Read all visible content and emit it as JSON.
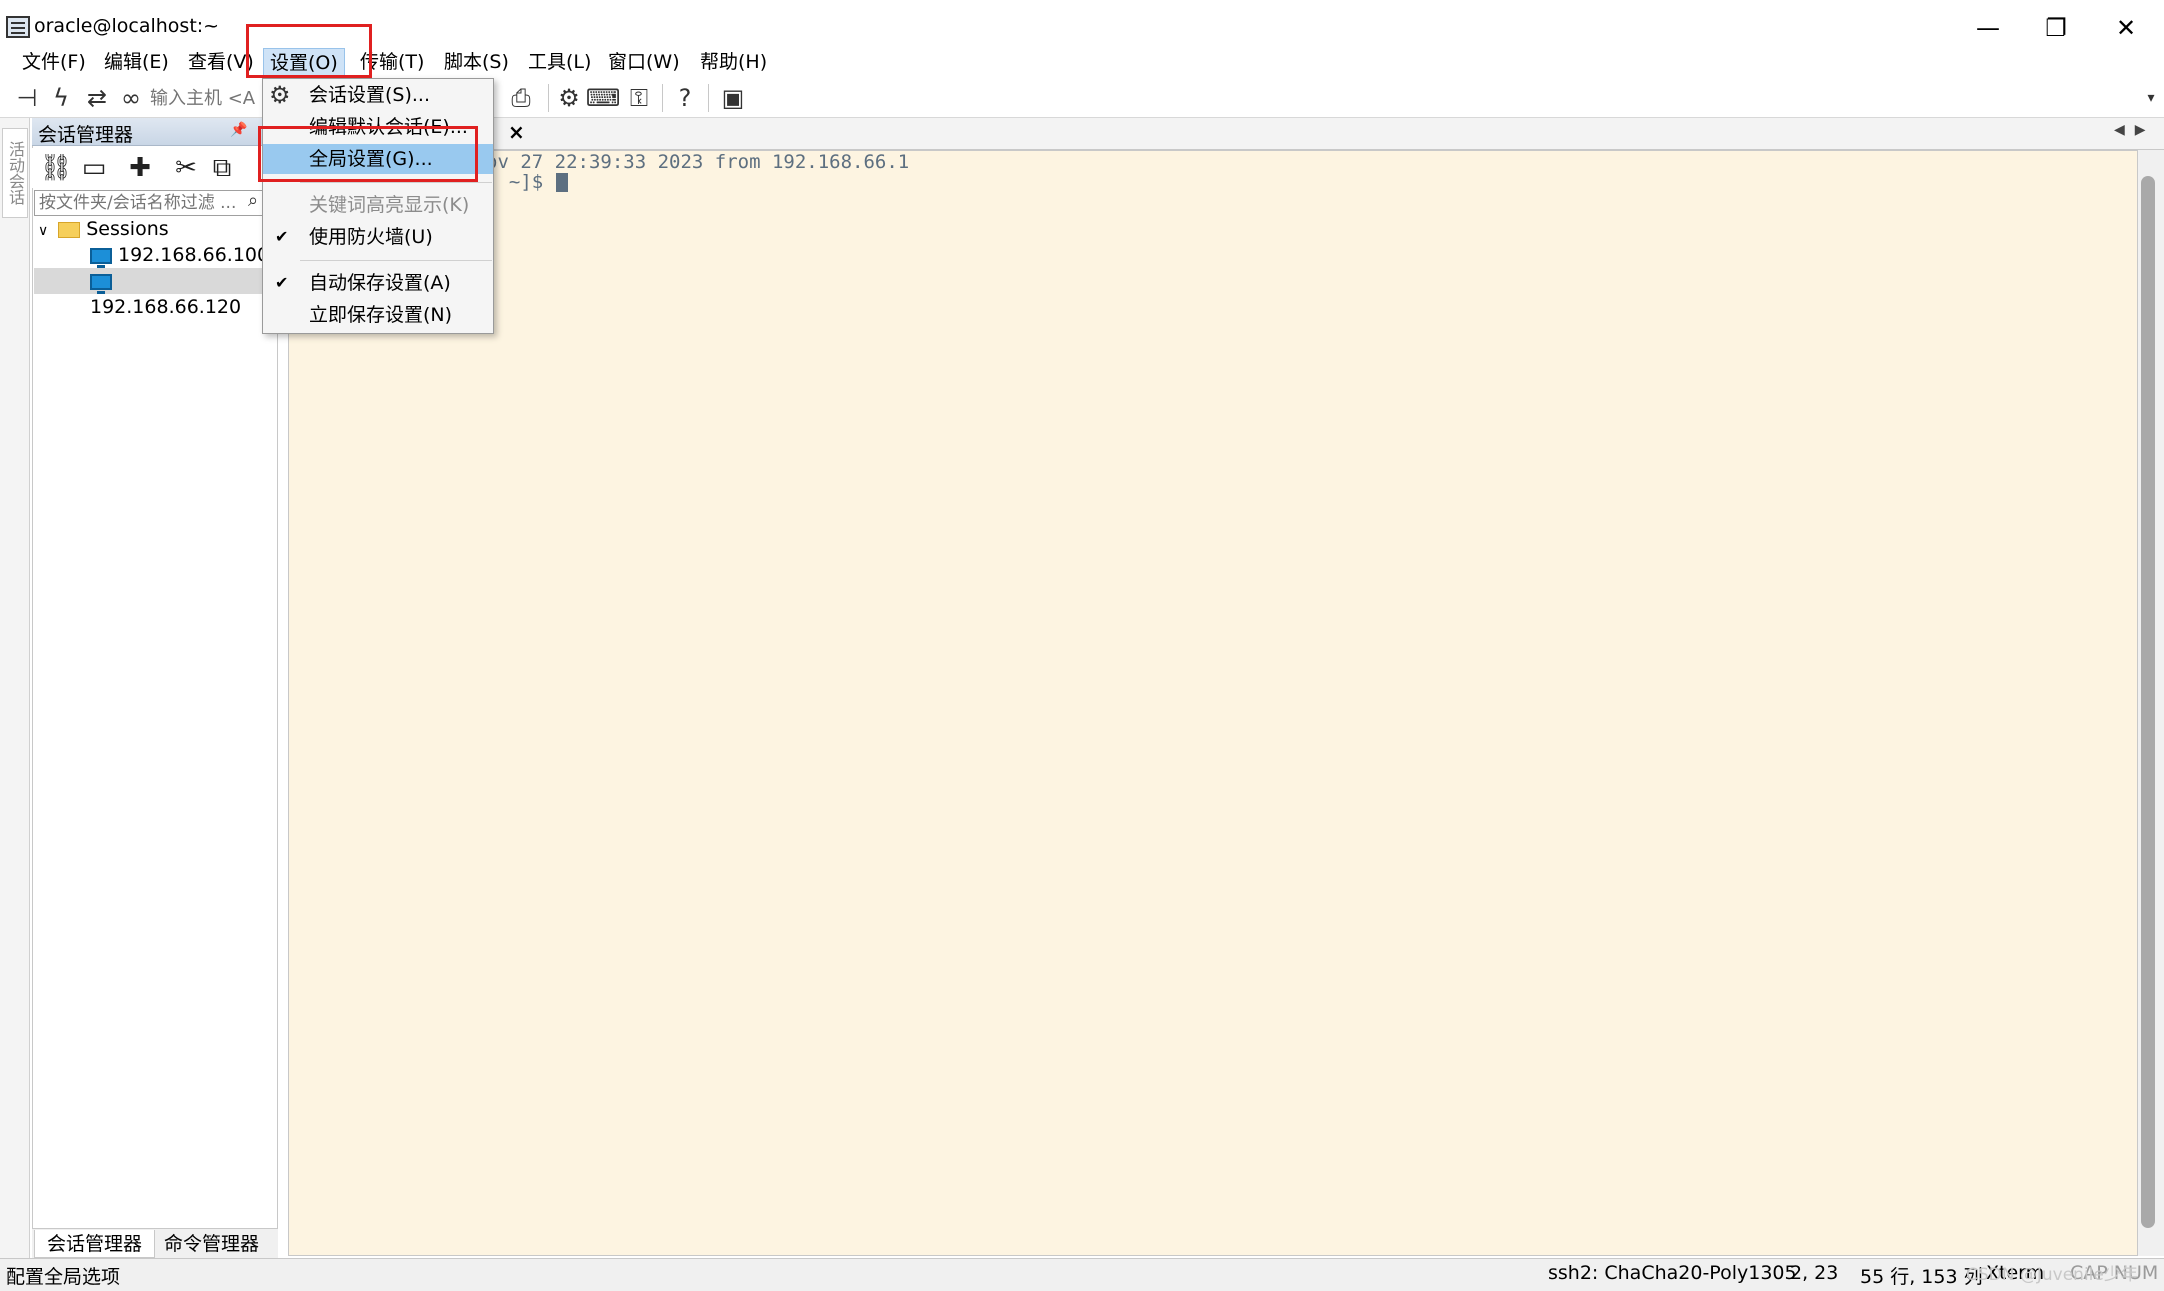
{
  "window": {
    "title": "oracle@localhost:~",
    "minimize": "—",
    "maximize": "❐",
    "close": "✕"
  },
  "menubar": [
    {
      "label": "文件(F)"
    },
    {
      "label": "编辑(E)"
    },
    {
      "label": "查看(V)"
    },
    {
      "label": "设置(O)"
    },
    {
      "label": "传输(T)"
    },
    {
      "label": "脚本(S)"
    },
    {
      "label": "工具(L)"
    },
    {
      "label": "窗口(W)"
    },
    {
      "label": "帮助(H)"
    }
  ],
  "toolbar": {
    "host_placeholder": "输入主机 <A"
  },
  "side_strip": {
    "tab_label": "活动会话"
  },
  "session_manager": {
    "title": "会话管理器",
    "filter_placeholder": "按文件夹/会话名称过滤 ...",
    "tree": {
      "root": "Sessions",
      "sessions": [
        "192.168.66.100",
        "192.168.66.120"
      ]
    },
    "bottom_tabs": [
      "会话管理器",
      "命令管理器"
    ]
  },
  "terminal": {
    "line1": "ov 27 22:39:33 2023 from 192.168.66.1",
    "line2": ": ~]$ "
  },
  "dropdown": {
    "items": [
      {
        "label": "会话设置(S)...",
        "icon": "gear-icon"
      },
      {
        "label": "编辑默认会话(E)..."
      },
      {
        "label": "全局设置(G)...",
        "highlighted": true
      },
      {
        "label": "关键词高亮显示(K)",
        "disabled": true
      },
      {
        "label": "使用防火墙(U)",
        "checked": true
      },
      {
        "label": "自动保存设置(A)",
        "checked": true
      },
      {
        "label": "立即保存设置(N)"
      }
    ]
  },
  "status": {
    "hint": "配置全局选项",
    "protocol": "ssh2: ChaCha20-Poly1305",
    "cursor": "2,  23",
    "size": "55 行, 153 列",
    "term": "Xterm",
    "caps": "CAP NUM",
    "watermark": "CSDN @Juvenile少年"
  },
  "colors": {
    "highlight_box": "#e02020",
    "menu_highlight": "#99c9ef",
    "terminal_bg": "#fdf4e1"
  }
}
